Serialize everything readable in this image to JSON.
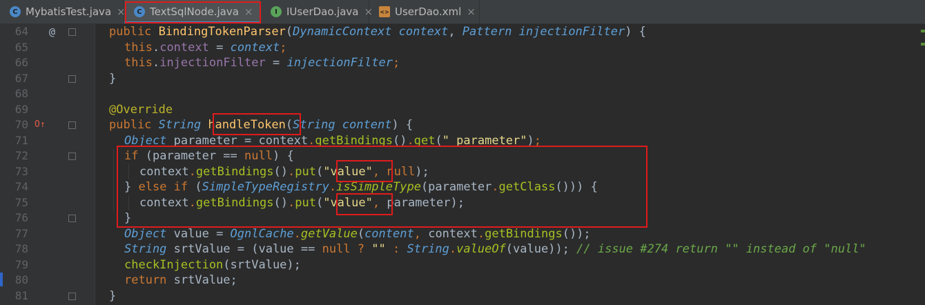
{
  "tabs": [
    {
      "label": "MybatisTest.java",
      "icon": "class-icon",
      "color": "#4a88c7",
      "letter": "C"
    },
    {
      "label": "TextSqlNode.java",
      "icon": "class-icon",
      "color": "#4a88c7",
      "letter": "C",
      "active": true
    },
    {
      "label": "IUserDao.java",
      "icon": "interface-icon",
      "color": "#5aa35a",
      "letter": "I"
    },
    {
      "label": "UserDao.xml",
      "icon": "xml-file-icon",
      "color": "#c8853d",
      "letter": "<>"
    }
  ],
  "close_glyph": "×",
  "line_numbers": [
    "64",
    "65",
    "66",
    "67",
    "68",
    "69",
    "70",
    "71",
    "72",
    "73",
    "74",
    "75",
    "76",
    "77",
    "78",
    "79",
    "80",
    "81"
  ],
  "gutter": {
    "at_marker": "@",
    "override_marker": "O↑"
  },
  "code": {
    "l64": {
      "a": "public ",
      "b": "BindingTokenParser",
      "c": "(",
      "d": "DynamicContext context",
      "e": ", ",
      "f": "Pattern injectionFilter",
      "g": ") {"
    },
    "l65": {
      "a": "this",
      "b": ".",
      "c": "context",
      "d": " = ",
      "e": "context",
      "f": ";"
    },
    "l66": {
      "a": "this",
      "b": ".",
      "c": "injectionFilter",
      "d": " = ",
      "e": "injectionFilter",
      "f": ";"
    },
    "l67": {
      "a": "}"
    },
    "l69": {
      "a": "@Override"
    },
    "l70": {
      "a": "public ",
      "b": "String ",
      "c": "handleToken",
      "d": "(",
      "e": "String content",
      "f": ") {"
    },
    "l71": {
      "a": "Object ",
      "b": "parameter = ",
      "c": "context",
      "d": ".",
      "e": "getBindings",
      "f": "()",
      "g": ".",
      "h": "get",
      "i": "(",
      "j": "\" parameter\"",
      "k": ")",
      "l": ";"
    },
    "l72": {
      "a": "if ",
      "b": "(parameter == ",
      "c": "null",
      "d": ") {"
    },
    "l73": {
      "a": "context",
      "b": ".",
      "c": "getBindings",
      "d": "()",
      "e": ".",
      "f": "put",
      "g": "(",
      "h": "\"value\"",
      "i": ", ",
      "j": "null",
      "k": ");"
    },
    "l74": {
      "a": "} ",
      "b": "else if ",
      "c": "(",
      "d": "SimpleTypeRegistry",
      "e": ".",
      "f": "isSimpleType",
      "g": "(parameter",
      "h": ".",
      "i": "getClass",
      "j": "())) {"
    },
    "l75": {
      "a": "context",
      "b": ".",
      "c": "getBindings",
      "d": "()",
      "e": ".",
      "f": "put",
      "g": "(",
      "h": "\"value\"",
      "i": ", ",
      "j": "parameter",
      "k": ");"
    },
    "l76": {
      "a": "}"
    },
    "l77": {
      "a": "Object ",
      "b": "value = ",
      "c": "OgnlCache",
      "d": ".",
      "e": "getValue",
      "f": "(",
      "g": "content",
      "h": ", ",
      "i": "context",
      "j": ".",
      "k": "getBindings",
      "l": "());"
    },
    "l78": {
      "a": "String ",
      "b": "srtValue = (value == ",
      "c": "null",
      "d": " ? ",
      "e": "\"\"",
      "f": " : ",
      "g": "String",
      "h": ".",
      "i": "valueOf",
      "j": "(value)); ",
      "k": "// issue #274 return \"\" instead of \"null\""
    },
    "l79": {
      "a": "checkInjection",
      "b": "(srtValue);"
    },
    "l80": {
      "a": "return ",
      "b": "srtValue;"
    },
    "l81": {
      "a": "}"
    }
  },
  "colors": {
    "highlight_box": "#e01b1b",
    "tab_underline": "#4a88c7"
  }
}
